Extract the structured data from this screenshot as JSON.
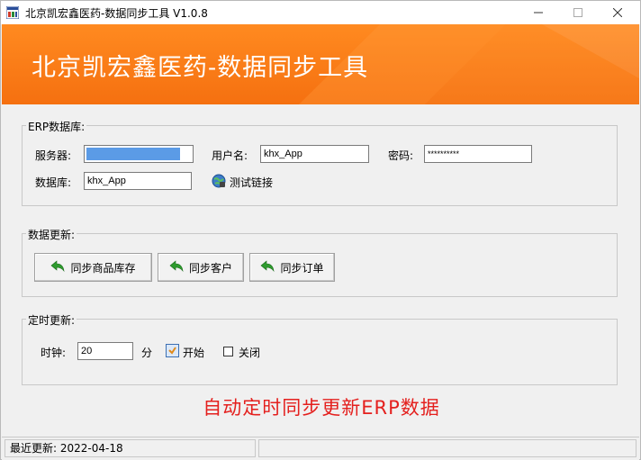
{
  "window": {
    "title": "北京凯宏鑫医药-数据同步工具 V1.0.8",
    "icon": "app-icon",
    "controls": {
      "minimize": "—",
      "maximize": "☐",
      "close": "✕"
    }
  },
  "banner": {
    "title": "北京凯宏鑫医药-数据同步工具"
  },
  "erp": {
    "group_label": "ERP数据库:",
    "server_label": "服务器:",
    "server_value": "",
    "username_label": "用户名:",
    "username_value": "khx_App",
    "password_label": "密码:",
    "password_value": "**********",
    "database_label": "数据库:",
    "database_value": "khx_App",
    "test_link_label": "测试链接"
  },
  "update": {
    "group_label": "数据更新:",
    "buttons": [
      {
        "label": "同步商品库存",
        "icon": "back-arrow-icon"
      },
      {
        "label": "同步客户",
        "icon": "back-arrow-icon"
      },
      {
        "label": "同步订单",
        "icon": "back-arrow-icon"
      }
    ]
  },
  "timer": {
    "group_label": "定时更新:",
    "clock_label": "时钟:",
    "clock_value": "20",
    "unit_label": "分",
    "start_label": "开始",
    "close_label": "关闭",
    "close_checked": false
  },
  "message": "自动定时同步更新ERP数据",
  "status": {
    "last_update": "最近更新: 2022-04-18",
    "right": ""
  },
  "colors": {
    "banner": "#f57010",
    "message": "#e4201e",
    "button_arrow": "#2e9b2e"
  }
}
